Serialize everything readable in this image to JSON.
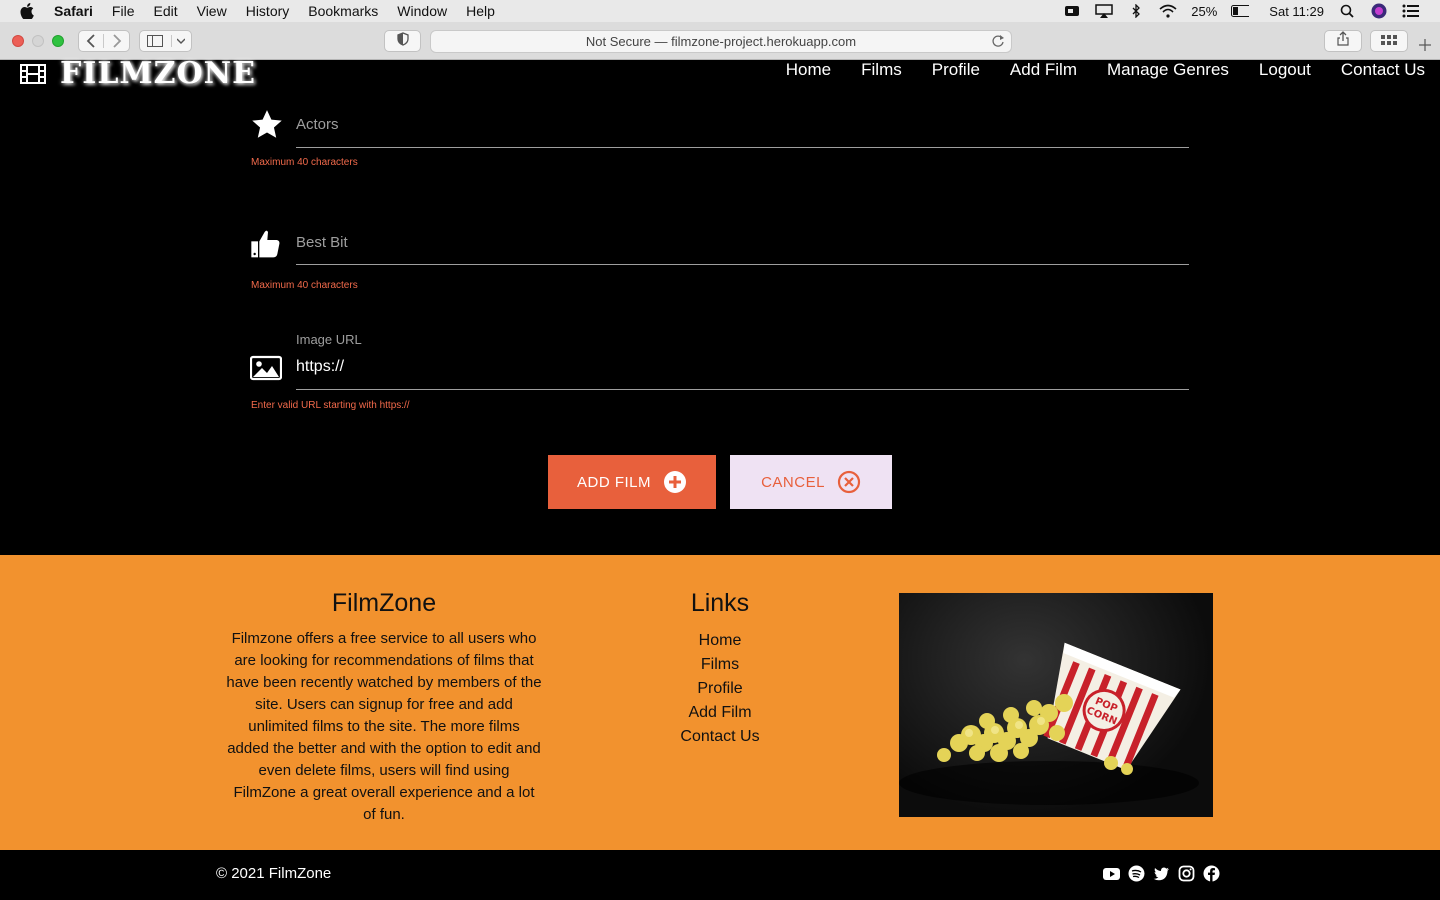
{
  "menubar": {
    "app": "Safari",
    "items": [
      "File",
      "Edit",
      "View",
      "History",
      "Bookmarks",
      "Window",
      "Help"
    ],
    "battery": "25%",
    "clock": "Sat 11:29"
  },
  "browser": {
    "url": "Not Secure — filmzone-project.herokuapp.com"
  },
  "site": {
    "logo": "FILMZONE",
    "nav": [
      "Home",
      "Films",
      "Profile",
      "Add Film",
      "Manage Genres",
      "Logout",
      "Contact Us"
    ]
  },
  "form": {
    "actors": {
      "placeholder": "Actors",
      "helper": "Maximum 40 characters"
    },
    "best_bit": {
      "placeholder": "Best Bit",
      "helper": "Maximum 40 characters"
    },
    "image_url": {
      "label": "Image URL",
      "value": "https://",
      "helper": "Enter valid URL starting with https://"
    },
    "add_button": "ADD FILM",
    "cancel_button": "CANCEL"
  },
  "footer": {
    "about_title": "FilmZone",
    "about_text": "Filmzone offers a free service to all users who are looking for recommendations of films that have been recently watched by members of the site. Users can signup for free and add unlimited films to the site. The more films added the better and with the option to edit and even delete films, users will find using FilmZone a great overall experience and a lot of fun.",
    "links_title": "Links",
    "links": [
      "Home",
      "Films",
      "Profile",
      "Add Film",
      "Contact Us"
    ],
    "copyright": "© 2021 FilmZone",
    "socials": [
      "youtube-icon",
      "spotify-icon",
      "twitter-icon",
      "instagram-icon",
      "facebook-icon"
    ]
  },
  "colors": {
    "accent": "#e8603c",
    "footer_bg": "#f2922e",
    "cancel_bg": "#efe2f3",
    "helper_text": "#f26a4b"
  }
}
